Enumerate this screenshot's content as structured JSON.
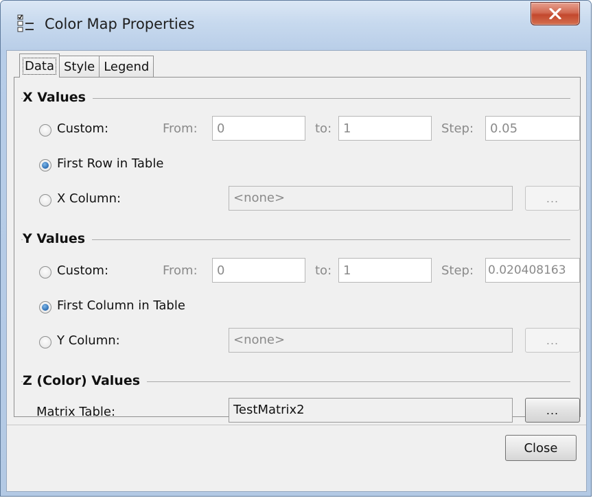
{
  "window": {
    "title": "Color Map Properties"
  },
  "tabs": [
    {
      "label": "Data",
      "active": true
    },
    {
      "label": "Style",
      "active": false
    },
    {
      "label": "Legend",
      "active": false
    }
  ],
  "x_values": {
    "title": "X Values",
    "custom_label": "Custom:",
    "from_label": "From:",
    "from_value": "0",
    "to_label": "to:",
    "to_value": "1",
    "step_label": "Step:",
    "step_value": "0.05",
    "first_row_label": "First Row in Table",
    "column_label": "X Column:",
    "column_value": "<none>",
    "browse_label": "...",
    "selected": "first_row"
  },
  "y_values": {
    "title": "Y Values",
    "custom_label": "Custom:",
    "from_label": "From:",
    "from_value": "0",
    "to_label": "to:",
    "to_value": "1",
    "step_label": "Step:",
    "step_value": "0.020408163",
    "first_column_label": "First Column in Table",
    "column_label": "Y Column:",
    "column_value": "<none>",
    "browse_label": "...",
    "selected": "first_column"
  },
  "z_values": {
    "title": "Z (Color) Values",
    "matrix_label": "Matrix Table:",
    "matrix_value": "TestMatrix2",
    "browse_label": "..."
  },
  "footer": {
    "close_label": "Close"
  },
  "colors": {
    "accent": "#2a6cb3",
    "close_red": "#c3482d"
  },
  "icons": {
    "app": "properties-icon",
    "close": "close-x-icon"
  }
}
